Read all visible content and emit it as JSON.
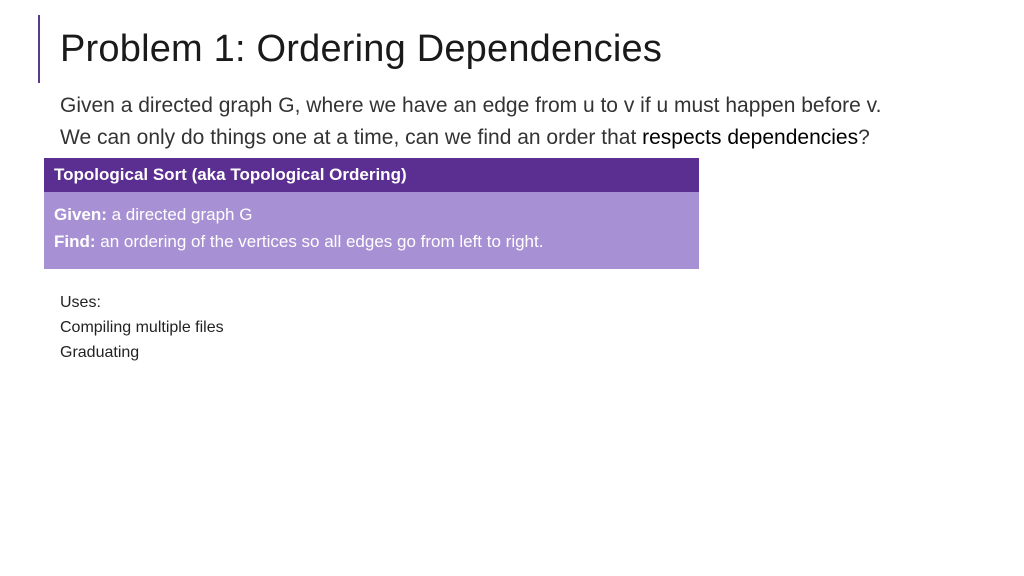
{
  "title": "Problem 1: Ordering Dependencies",
  "para1": "Given a directed graph G, where we have an edge from u to v if u must happen before v.",
  "para2_a": "We can only do things one at a time, can we find an order that ",
  "para2_b": "respects dependencies",
  "para2_c": "?",
  "definition": {
    "header": "Topological Sort (aka Topological Ordering)",
    "given_label": "Given:",
    "given_text": " a directed graph G",
    "find_label": "Find:",
    "find_text": " an ordering of the vertices so all edges go from left to right."
  },
  "uses": {
    "heading": "Uses:",
    "item1": "Compiling multiple files",
    "item2": "Graduating"
  }
}
